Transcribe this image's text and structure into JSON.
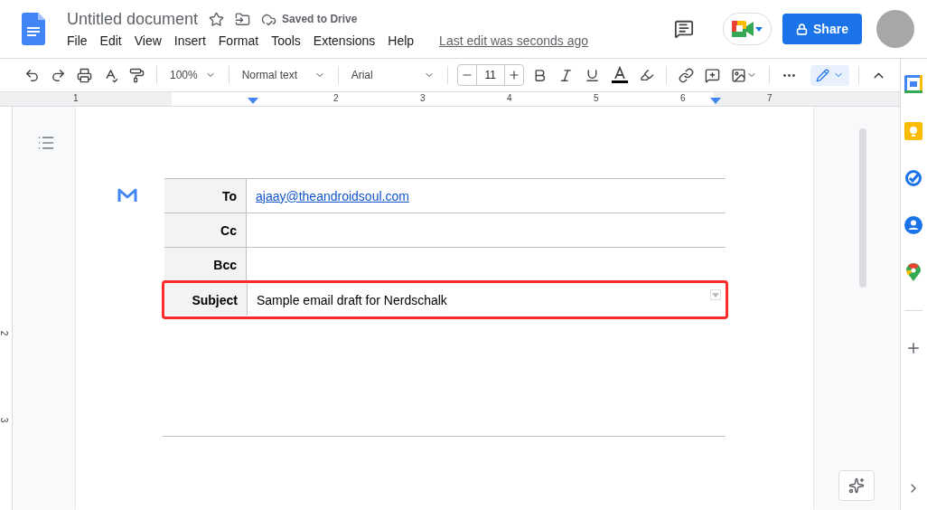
{
  "document": {
    "title": "Untitled document",
    "save_status": "Saved to Drive"
  },
  "menu": [
    "File",
    "Edit",
    "View",
    "Insert",
    "Format",
    "Tools",
    "Extensions",
    "Help"
  ],
  "last_edit": "Last edit was seconds ago",
  "share_button": "Share",
  "toolbar": {
    "zoom": "100%",
    "style": "Normal text",
    "font": "Arial",
    "font_size": "11"
  },
  "ruler": {
    "horizontal": [
      "1",
      "2",
      "3",
      "4",
      "5",
      "6",
      "7"
    ],
    "vertical": [
      "2",
      "3"
    ]
  },
  "email_draft": {
    "rows": [
      {
        "label": "To",
        "value": "ajaay@theandroidsoul.com",
        "kind": "link",
        "highlighted": false
      },
      {
        "label": "Cc",
        "highlighted": false
      },
      {
        "label": "Bcc",
        "highlighted": false
      },
      {
        "label": "Subject",
        "value": "Sample email draft for Nerdschalk",
        "kind": "text",
        "highlighted": true
      }
    ]
  }
}
